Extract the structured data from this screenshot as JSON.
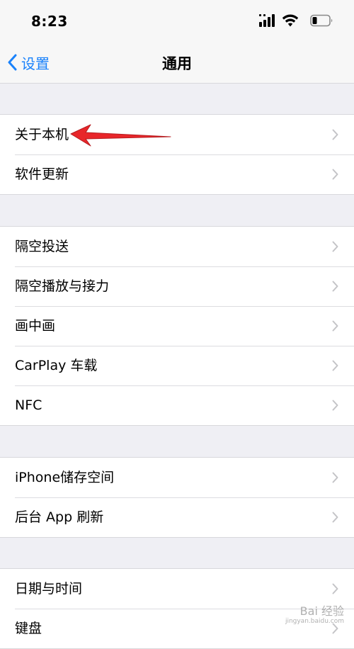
{
  "status_bar": {
    "time": "8:23",
    "icons": [
      "cellular-signal-icon",
      "wifi-icon",
      "battery-icon"
    ]
  },
  "nav": {
    "back_label": "设置",
    "title": "通用",
    "accent_color": "#1a82fb"
  },
  "groups": [
    {
      "rows": [
        {
          "label": "关于本机"
        },
        {
          "label": "软件更新"
        }
      ]
    },
    {
      "rows": [
        {
          "label": "隔空投送"
        },
        {
          "label": "隔空播放与接力"
        },
        {
          "label": "画中画"
        },
        {
          "label": "CarPlay 车载"
        },
        {
          "label": "NFC"
        }
      ]
    },
    {
      "rows": [
        {
          "label": "iPhone储存空间"
        },
        {
          "label": "后台 App 刷新"
        }
      ]
    },
    {
      "rows": [
        {
          "label": "日期与时间"
        },
        {
          "label": "键盘"
        }
      ]
    }
  ],
  "annotation": {
    "type": "red-arrow",
    "color": "#e8262a"
  },
  "watermark": {
    "text": "Bai 经验",
    "sub": "jingyan.baidu.com"
  }
}
